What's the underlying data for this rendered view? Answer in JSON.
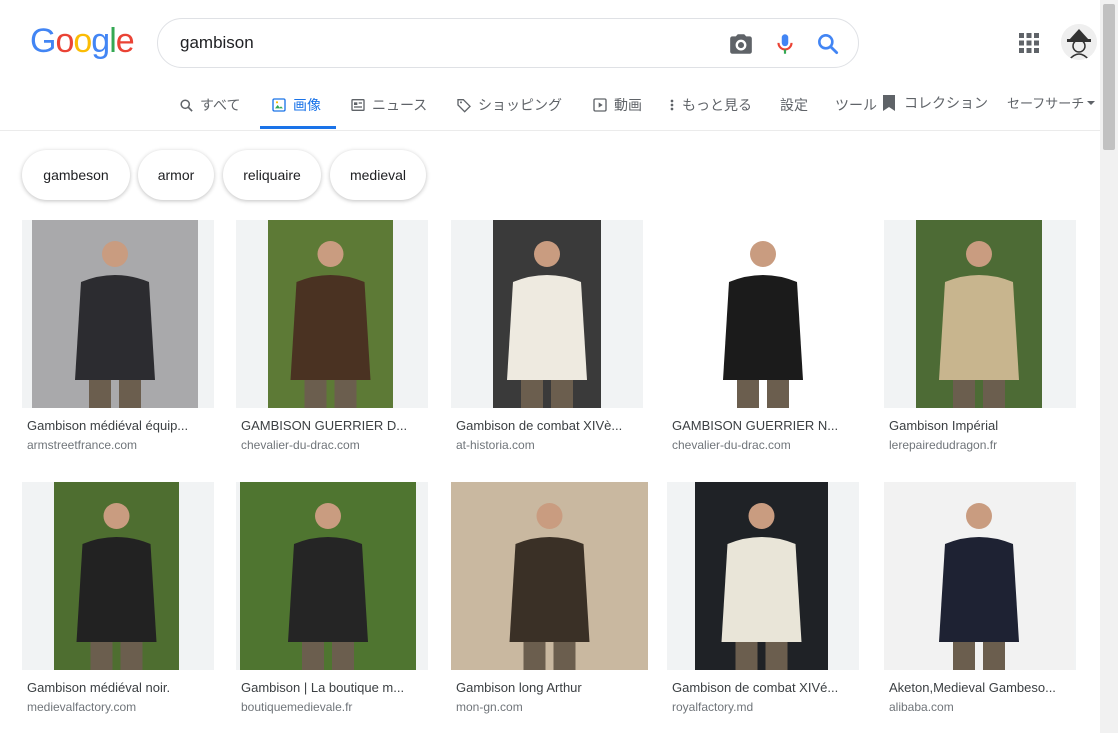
{
  "logo": {
    "letters": [
      "G",
      "o",
      "o",
      "g",
      "l",
      "e"
    ],
    "colors": [
      "#4285F4",
      "#EA4335",
      "#FBBC05",
      "#4285F4",
      "#34A853",
      "#EA4335"
    ]
  },
  "search": {
    "query": "gambison",
    "icons": [
      "camera-icon",
      "mic-icon",
      "search-icon"
    ]
  },
  "tabs": [
    {
      "label": "すべて",
      "icon": "search-icon"
    },
    {
      "label": "画像",
      "icon": "image-icon"
    },
    {
      "label": "ニュース",
      "icon": "news-icon"
    },
    {
      "label": "ショッピング",
      "icon": "tag-icon"
    },
    {
      "label": "動画",
      "icon": "play-icon"
    },
    {
      "label": "もっと見る",
      "icon": "more-vert-icon"
    },
    {
      "label": "設定",
      "icon": ""
    },
    {
      "label": "ツール",
      "icon": ""
    },
    {
      "label": "コレクション",
      "icon": "bookmark-icon"
    },
    {
      "label": "セーフサーチ",
      "icon": "dropdown-icon"
    }
  ],
  "chips": [
    "gambeson",
    "armor",
    "reliquaire",
    "medieval"
  ],
  "results": [
    {
      "caption": "Gambison médiéval équip...",
      "source": "armstreetfrance.com",
      "garment": "#2c2c30",
      "bg": "#a9a9ab"
    },
    {
      "caption": "GAMBISON GUERRIER D...",
      "source": "chevalier-du-drac.com",
      "garment": "#4a3222",
      "bg": "#5d7a36"
    },
    {
      "caption": "Gambison de combat XIVè...",
      "source": "at-historia.com",
      "garment": "#eeeae0",
      "bg": "#3a3a3a"
    },
    {
      "caption": "GAMBISON GUERRIER N...",
      "source": "chevalier-du-drac.com",
      "garment": "#1b1b1b",
      "bg": "#ffffff"
    },
    {
      "caption": "Gambison Impérial",
      "source": "lerepairedudragon.fr",
      "garment": "#c8b58e",
      "bg": "#4d6b35"
    },
    {
      "caption": "Gambison médiéval noir.",
      "source": "medievalfactory.com",
      "garment": "#222222",
      "bg": "#4e6e30"
    },
    {
      "caption": "Gambison | La boutique m...",
      "source": "boutiquemedievale.fr",
      "garment": "#252525",
      "bg": "#4f7530"
    },
    {
      "caption": "Gambison long Arthur",
      "source": "mon-gn.com",
      "garment": "#3a3026",
      "bg": "#c9b8a0"
    },
    {
      "caption": "Gambison de combat XIVé...",
      "source": "royalfactory.md",
      "garment": "#e9e5d8",
      "bg": "#1f2226"
    },
    {
      "caption": "Aketon,Medieval Gambeso...",
      "source": "alibaba.com",
      "garment": "#1e2233",
      "bg": "#f2f2f2"
    }
  ]
}
